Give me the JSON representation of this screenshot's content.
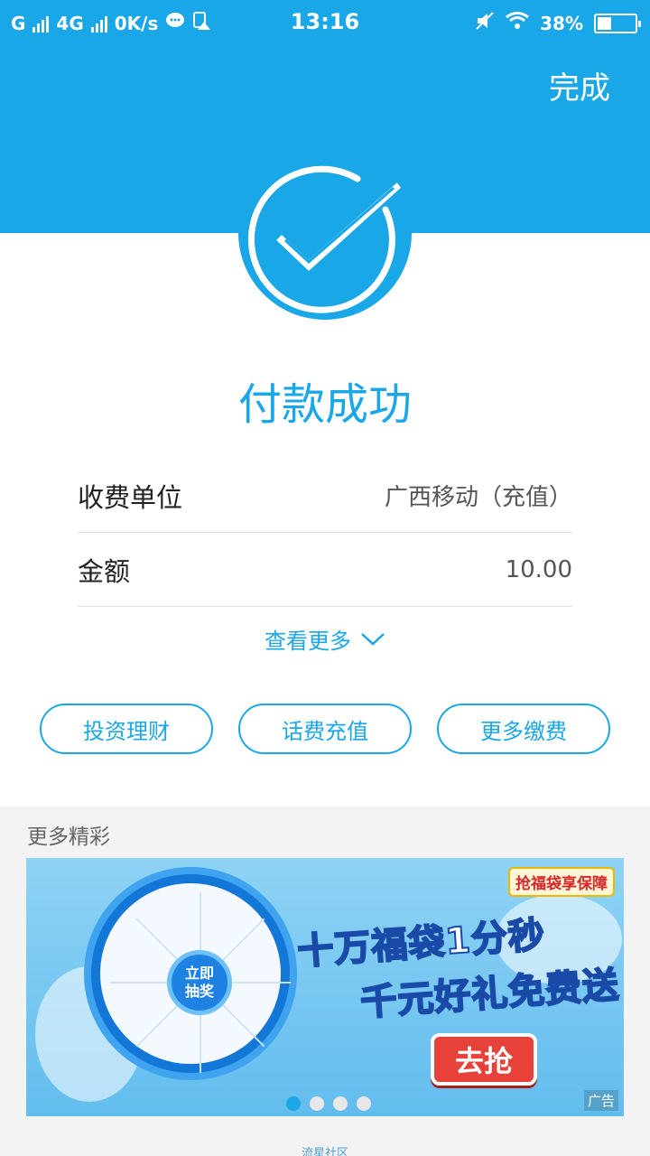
{
  "status_bar": {
    "carrier1": "G",
    "carrier2": "4G",
    "speed": "0K/s",
    "time": "13:16",
    "battery": "38%",
    "battery_level": 0.38
  },
  "header": {
    "done_label": "完成"
  },
  "result": {
    "title": "付款成功"
  },
  "details": [
    {
      "label": "收费单位",
      "value": "广西移动（充值）"
    },
    {
      "label": "金额",
      "value": "10.00"
    }
  ],
  "view_more": "查看更多",
  "actions": [
    "投资理财",
    "话费充值",
    "更多缴费"
  ],
  "more": {
    "title": "更多精彩",
    "banner": {
      "wheel_center": "立即\n抽奖",
      "badge": "抢福袋享保障",
      "headline1": "十万福袋1分秒",
      "headline2_a": "千元好礼",
      "headline2_b": "免费送",
      "button": "去抢",
      "ad_label": "广告",
      "page_count": 4,
      "active_page": 0
    }
  },
  "footer": "流星社区",
  "colors": {
    "primary": "#1aa7e8",
    "ad_button": "#e8413a"
  }
}
